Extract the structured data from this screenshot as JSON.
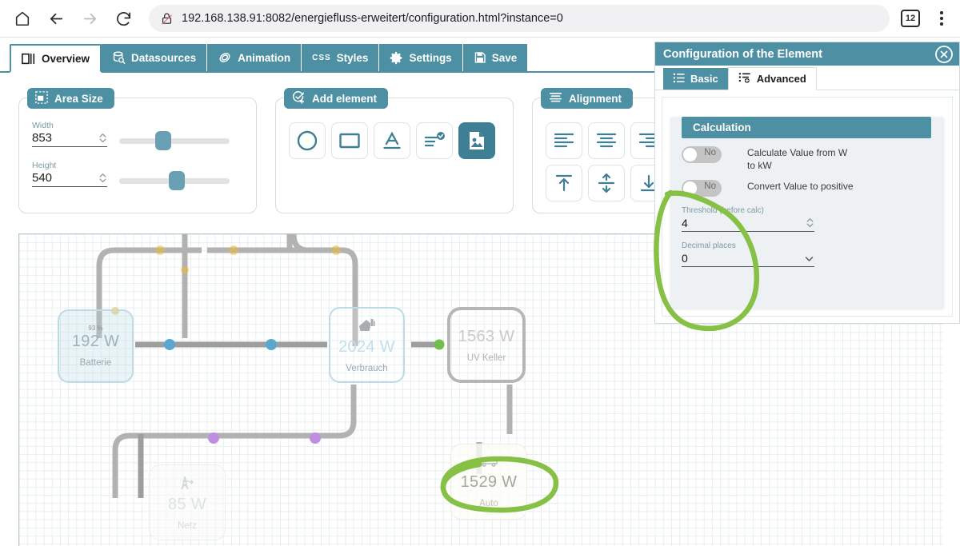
{
  "browser": {
    "url": "192.168.138.91:8082/energiefluss-erweitert/configuration.html?instance=0",
    "tab_count": "12",
    "icons": {
      "home": "home-icon",
      "back": "back-arrow-icon",
      "forward": "forward-arrow-icon",
      "reload": "reload-icon",
      "insecure": "insecure-lock-icon",
      "menu": "kebab-menu-icon"
    }
  },
  "app_tabs": [
    {
      "label": "Overview",
      "icon": "overview-icon",
      "active": true
    },
    {
      "label": "Datasources",
      "icon": "database-icon",
      "active": false
    },
    {
      "label": "Animation",
      "icon": "animation-icon",
      "active": false
    },
    {
      "label": "Styles",
      "icon": "css-icon",
      "active": false
    },
    {
      "label": "Settings",
      "icon": "gear-icon",
      "active": false
    },
    {
      "label": "Save",
      "icon": "save-disk-icon",
      "active": false
    }
  ],
  "panels": {
    "area_size": {
      "title": "Area Size",
      "icon": "area-size-icon",
      "width": {
        "label": "Width",
        "value": "853"
      },
      "height": {
        "label": "Height",
        "value": "540"
      }
    },
    "add_element": {
      "title": "Add element",
      "icon": "add-element-icon",
      "buttons": [
        {
          "name": "circle-shape-button"
        },
        {
          "name": "rectangle-shape-button"
        },
        {
          "name": "text-element-button"
        },
        {
          "name": "list-element-button"
        },
        {
          "name": "image-element-button"
        }
      ]
    },
    "alignment": {
      "title": "Alignment",
      "icon": "alignment-icon",
      "buttons": [
        {
          "name": "align-left-button"
        },
        {
          "name": "align-center-button"
        },
        {
          "name": "align-right-button"
        },
        {
          "name": "align-top-button"
        },
        {
          "name": "align-middle-button"
        },
        {
          "name": "align-bottom-button"
        }
      ]
    }
  },
  "config_dialog": {
    "title": "Configuration of the Element",
    "close_icon": "close-icon",
    "tabs": [
      {
        "label": "Basic",
        "icon": "list-icon",
        "selected": true
      },
      {
        "label": "Advanced",
        "icon": "list-add-icon",
        "selected": false
      }
    ],
    "calculation": {
      "title": "Calculation",
      "switches": [
        {
          "state": "No",
          "label": "Calculate Value from W to kW"
        },
        {
          "state": "No",
          "label": "Convert Value to positive"
        }
      ],
      "threshold": {
        "label": "Threshold (before calc)",
        "value": "4"
      },
      "decimals": {
        "label": "Decimal places",
        "value": "0"
      }
    }
  },
  "canvas": {
    "nodes": [
      {
        "pct": "93 %",
        "value": "192 W",
        "caption": "Batterie",
        "icon": "",
        "style": "selected-blue"
      },
      {
        "pct": "",
        "value": "2024 W",
        "caption": "Verbrauch",
        "icon": "house-icon",
        "style": "selected-blue"
      },
      {
        "pct": "",
        "value": "1563 W",
        "caption": "UV Keller",
        "icon": "",
        "style": "grey-outline"
      },
      {
        "pct": "",
        "value": "85 W",
        "caption": "Netz",
        "icon": "grid-icon",
        "style": "faint"
      },
      {
        "pct": "",
        "value": "1529 W",
        "caption": "Auto",
        "icon": "car-icon",
        "style": "faint"
      }
    ],
    "dot_colors": {
      "blue": "#5aa7cf",
      "green": "#6fbf4a",
      "purple": "#c08ee0",
      "yellow": "#e8b93c"
    }
  },
  "theme": {
    "accent_teal": "#4d8fa3",
    "annotation_green": "#86c044",
    "panel_bg": "#edf1f3"
  }
}
